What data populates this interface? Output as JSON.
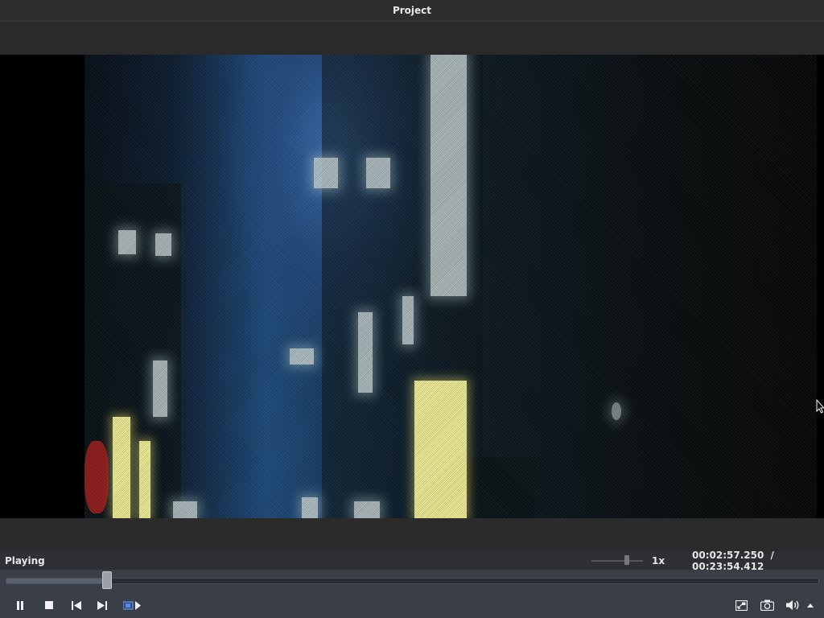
{
  "window": {
    "title": "Project"
  },
  "status": {
    "state": "Playing",
    "speed": "1x",
    "speed_level": 0.65
  },
  "time": {
    "current": "00:02:57.250",
    "separator": "/",
    "total": "00:23:54.412"
  },
  "seek": {
    "progress": 0.1234
  },
  "controls": {
    "pause_icon": "pause-icon",
    "stop_icon": "stop-icon",
    "prev_icon": "skip-previous-icon",
    "next_icon": "skip-next-icon",
    "frame_step_icon": "frame-step-icon",
    "fullscreen_icon": "fullscreen-icon",
    "snapshot_icon": "camera-icon",
    "volume_icon": "volume-icon",
    "volume_menu_icon": "caret-up-icon"
  },
  "colors": {
    "accent": "#3a3e47",
    "text": "#e6e6e6",
    "knob": "#9aa0a8"
  }
}
